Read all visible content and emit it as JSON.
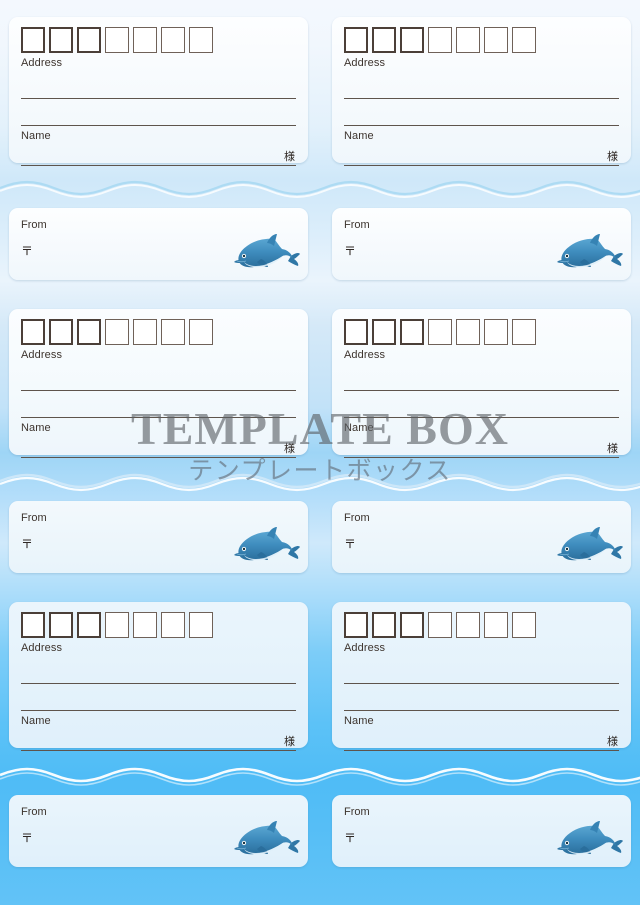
{
  "document": {
    "title": "Dolphin Address Label Sheet",
    "theme_colors": {
      "background_top": "#f4f8fe",
      "background_bottom": "#62c3f7",
      "wave_light": "#d6ecfb",
      "wave_white": "#ffffff",
      "card_light": "#fdfeff",
      "card_tinted": "#e4f2fb",
      "ink": "#3d342e",
      "rule": "#5e544c",
      "dolphin_body": "#3e8cbe",
      "dolphin_dark": "#2b6f9e",
      "dolphin_belly": "#dff0fa"
    }
  },
  "labels": {
    "address": "Address",
    "name": "Name",
    "honorific": "様",
    "from": "From",
    "postal_mark": "〒"
  },
  "postal_boxes": {
    "count": 7,
    "heavy_count": 3,
    "light_count": 4
  },
  "watermark": {
    "main": "TEMPLATE BOX",
    "sub": "テンプレートボックス"
  },
  "icons": {
    "dolphin": "dolphin-icon",
    "postal": "postal-mark-icon",
    "wave": "wave-divider-icon"
  },
  "blocks": [
    {
      "id": "block-1",
      "address_tint": "tint-1",
      "from_tint": "tint-1"
    },
    {
      "id": "block-2",
      "address_tint": "tint-2",
      "from_tint": "tint-2"
    },
    {
      "id": "block-3",
      "address_tint": "tint-3",
      "from_tint": "tint-4"
    }
  ]
}
